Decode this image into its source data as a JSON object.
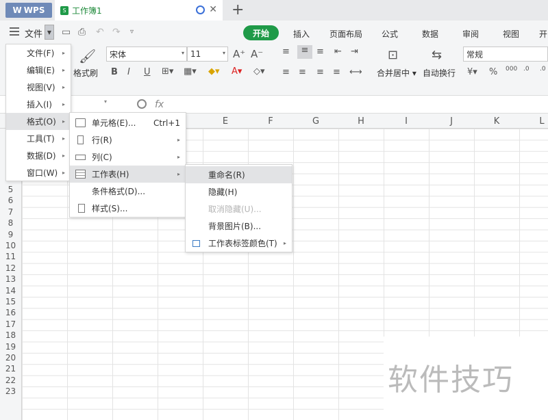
{
  "tabs": {
    "app": "WPS",
    "doc": "工作簿1"
  },
  "menubar": {
    "file": "文件",
    "kaishi": "开始",
    "ribbon_tabs": [
      "插入",
      "页面布局",
      "公式",
      "数据",
      "审阅",
      "视图",
      "开"
    ]
  },
  "ribbon": {
    "format_painter": "格式刷",
    "font_name": "宋体",
    "font_size": "11",
    "merge_center": "合并居中",
    "auto_wrap": "自动换行",
    "number_format": "常规",
    "bold": "B",
    "italic": "I",
    "underline": "U",
    "fx": "fx"
  },
  "columns": [
    "E",
    "F",
    "G",
    "H",
    "I",
    "J",
    "K",
    "L"
  ],
  "rows": [
    "5",
    "6",
    "7",
    "8",
    "9",
    "10",
    "11",
    "12",
    "13",
    "14",
    "15",
    "16",
    "17",
    "18",
    "19",
    "20",
    "21",
    "22",
    "23"
  ],
  "main_menu": [
    {
      "label": "文件(F)"
    },
    {
      "label": "编辑(E)"
    },
    {
      "label": "视图(V)"
    },
    {
      "label": "插入(I)"
    },
    {
      "label": "格式(O)"
    },
    {
      "label": "工具(T)"
    },
    {
      "label": "数据(D)"
    },
    {
      "label": "窗口(W)"
    }
  ],
  "format_menu": [
    {
      "label": "单元格(E)...",
      "shortcut": "Ctrl+1"
    },
    {
      "label": "行(R)"
    },
    {
      "label": "列(C)"
    },
    {
      "label": "工作表(H)"
    },
    {
      "label": "条件格式(D)..."
    },
    {
      "label": "样式(S)..."
    }
  ],
  "sheet_menu": [
    {
      "label": "重命名(R)"
    },
    {
      "label": "隐藏(H)"
    },
    {
      "label": "取消隐藏(U)..."
    },
    {
      "label": "背景图片(B)..."
    },
    {
      "label": "工作表标签颜色(T)"
    }
  ],
  "watermark": "软件技巧",
  "colors": {
    "accent_green": "#1f9a48",
    "wps_tab": "#6f8ab8",
    "highlight": "#e2e3e5"
  }
}
